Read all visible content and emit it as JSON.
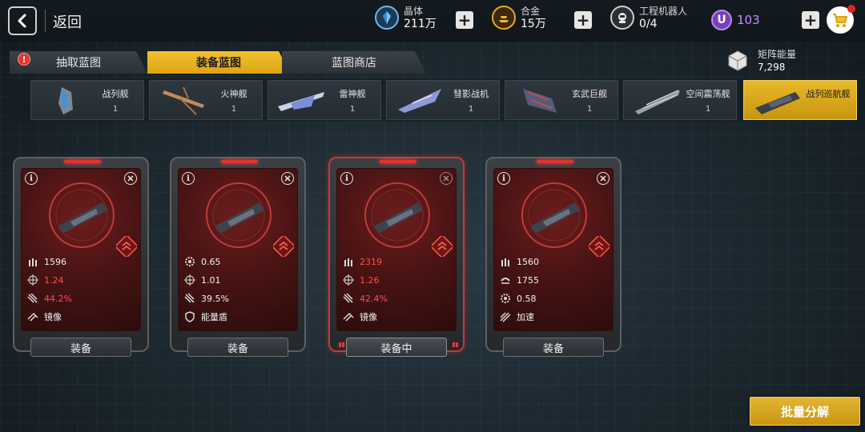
{
  "header": {
    "back_label": "返回",
    "resources": [
      {
        "name": "晶体",
        "value": "211万",
        "icon": "crystal-icon",
        "color": "#4aa8e8"
      },
      {
        "name": "合金",
        "value": "15万",
        "icon": "alloy-icon",
        "color": "#f2a51e"
      },
      {
        "name": "工程机器人",
        "value": "0/4",
        "icon": "robot-icon",
        "color": "#d8d8d8"
      }
    ],
    "premium": {
      "symbol": "U",
      "value": "103",
      "color": "#c58bff"
    }
  },
  "tabs": [
    {
      "label": "抽取蓝图",
      "active": false,
      "alert": "!"
    },
    {
      "label": "装备蓝图",
      "active": true
    },
    {
      "label": "蓝图商店",
      "active": false
    }
  ],
  "matrix": {
    "label": "矩阵能量",
    "value": "7,298"
  },
  "categories": [
    {
      "name": "战列舰",
      "count": "1"
    },
    {
      "name": "火神舰",
      "count": "1"
    },
    {
      "name": "雷神舰",
      "count": "1"
    },
    {
      "name": "彗影战机",
      "count": "1"
    },
    {
      "name": "玄武巨舰",
      "count": "1"
    },
    {
      "name": "空间震荡舰",
      "count": "1"
    },
    {
      "name": "战列巡航舰",
      "count": "",
      "active": true
    }
  ],
  "cards": [
    {
      "stats": [
        {
          "icon": "ammo-icon",
          "value": "1596",
          "red": false
        },
        {
          "icon": "crosshair-icon",
          "value": "1.24",
          "red": true
        },
        {
          "icon": "claw-icon",
          "value": "44.2%",
          "red": true
        },
        {
          "icon": "mirror-icon",
          "value": "镜像",
          "red": false
        }
      ],
      "footer": "装备",
      "equipped": false
    },
    {
      "stats": [
        {
          "icon": "gear-icon",
          "value": "0.65",
          "red": false
        },
        {
          "icon": "crosshair-icon",
          "value": "1.01",
          "red": false
        },
        {
          "icon": "claw-icon",
          "value": "39.5%",
          "red": false
        },
        {
          "icon": "shield-icon",
          "value": "能量盾",
          "red": false
        }
      ],
      "footer": "装备",
      "equipped": false
    },
    {
      "stats": [
        {
          "icon": "ammo-icon",
          "value": "2319",
          "red": true
        },
        {
          "icon": "crosshair-icon",
          "value": "1.26",
          "red": true
        },
        {
          "icon": "claw-icon",
          "value": "42.4%",
          "red": true
        },
        {
          "icon": "mirror-icon",
          "value": "镜像",
          "red": false
        }
      ],
      "footer": "装备中",
      "equipped": true
    },
    {
      "stats": [
        {
          "icon": "ammo-icon",
          "value": "1560",
          "red": false
        },
        {
          "icon": "armor-icon",
          "value": "1755",
          "red": false
        },
        {
          "icon": "gear-icon",
          "value": "0.58",
          "red": false
        },
        {
          "icon": "speed-icon",
          "value": "加速",
          "red": false
        }
      ],
      "footer": "装备",
      "equipped": false
    }
  ],
  "batch_button": "批量分解",
  "colors": {
    "accent": "#e3b434",
    "stat_red": "#ff4e4e",
    "card_red": "#4a1414"
  }
}
